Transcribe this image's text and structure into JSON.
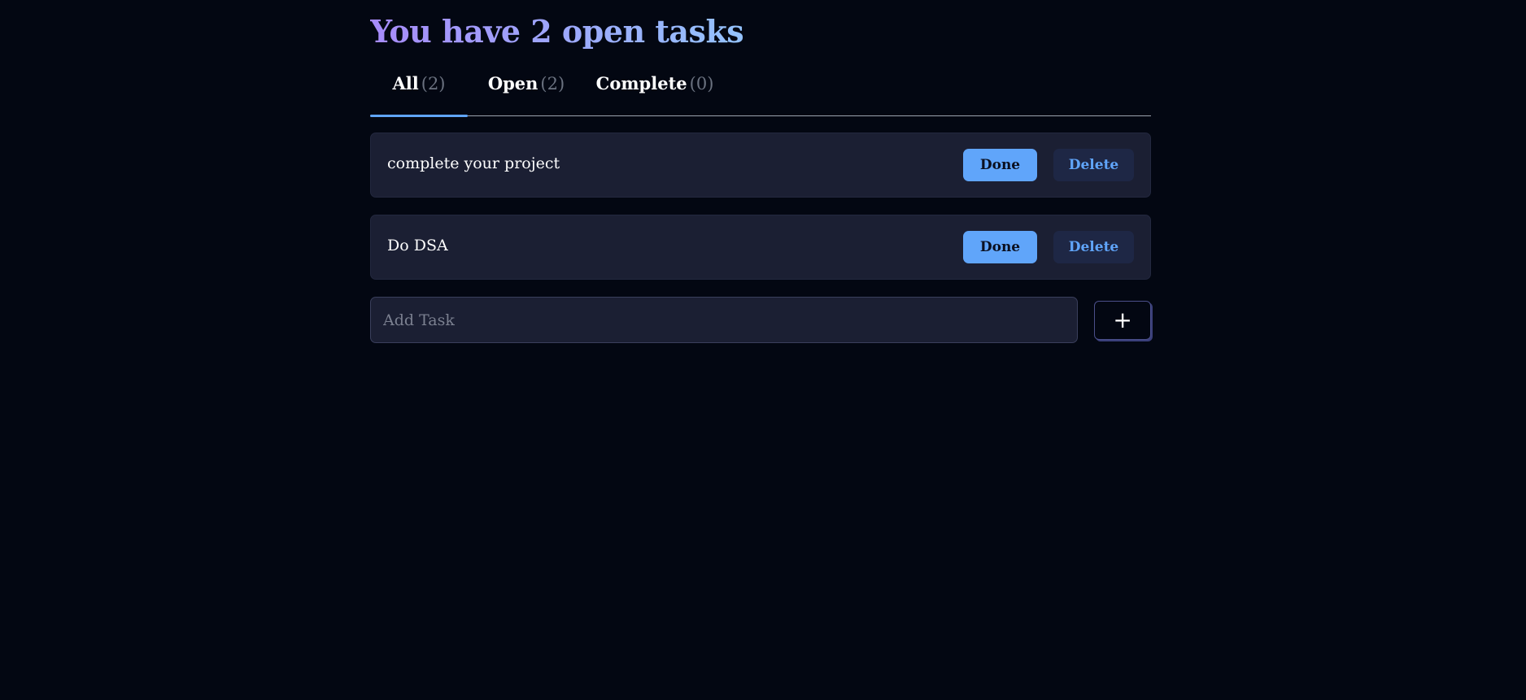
{
  "header": {
    "title": "You have 2 open tasks"
  },
  "tabs": [
    {
      "label": "All",
      "count": "(2)"
    },
    {
      "label": "Open",
      "count": "(2)"
    },
    {
      "label": "Complete",
      "count": "(0)"
    }
  ],
  "tasks": [
    {
      "text": "complete your project",
      "done_label": "Done",
      "delete_label": "Delete"
    },
    {
      "text": "Do DSA",
      "done_label": "Done",
      "delete_label": "Delete"
    }
  ],
  "add_task": {
    "placeholder": "Add Task",
    "value": "",
    "button_label": "+"
  },
  "colors": {
    "background": "#030712",
    "accent": "#60a5fa",
    "card": "#1b1f33",
    "title_gradient": [
      "#a78bfa",
      "#93c5fd",
      "#5eead4"
    ]
  }
}
